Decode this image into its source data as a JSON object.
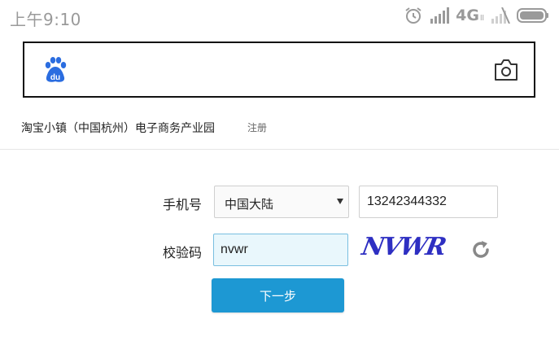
{
  "status_bar": {
    "time": "上午9:10",
    "network_label": "4G",
    "network_sub": "ll",
    "icons": [
      "alarm-icon",
      "signal-icon",
      "battery-icon"
    ]
  },
  "search_bar": {
    "logo_text": "du",
    "icons": [
      "baidu-paw-logo",
      "camera-icon"
    ]
  },
  "subheader": {
    "title": "淘宝小镇（中国杭州）电子商务产业园",
    "register": "注册"
  },
  "form": {
    "phone_label": "手机号",
    "country": "中国大陆",
    "phone_value": "13242344332",
    "captcha_label": "校验码",
    "captcha_value": "nvwr",
    "captcha_image_text": "NVWR",
    "next_button": "下一步"
  },
  "colors": {
    "accent": "#1d98d3",
    "baidu_blue": "#2b6de0",
    "captcha_input_bg": "#e9f7fc",
    "captcha_text": "#2e2fc2",
    "status_gray": "#9a9a9a"
  }
}
